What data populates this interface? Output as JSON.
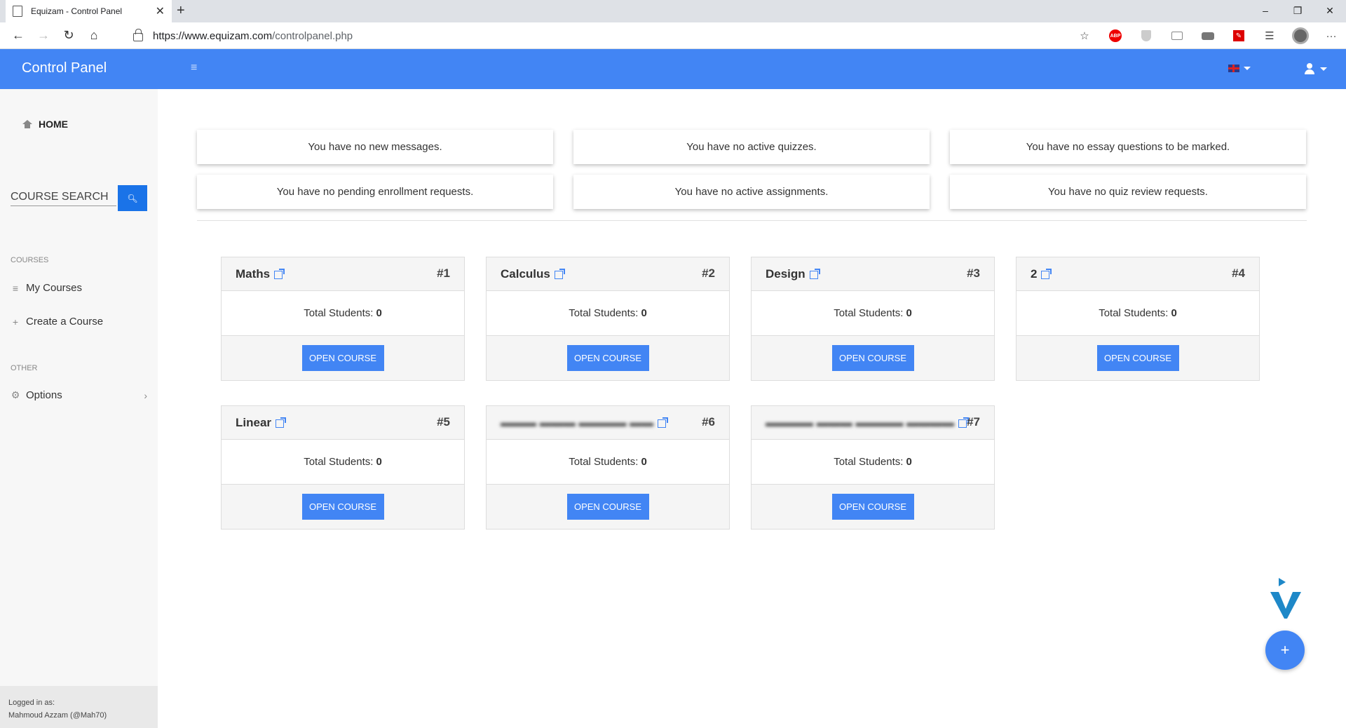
{
  "browser": {
    "tab_title": "Equizam - Control Panel",
    "url_host": "https://www.equizam.com",
    "url_path": "/controlpanel.php"
  },
  "appbar": {
    "brand": "Control Panel"
  },
  "sidebar": {
    "home": "HOME",
    "search_label": "COURSE SEARCH",
    "courses_heading": "COURSES",
    "my_courses": "My Courses",
    "create_course": "Create a Course",
    "other_heading": "OTHER",
    "options": "Options",
    "logged_in_label": "Logged in as:",
    "logged_in_user": "Mahmoud Azzam (@Mah70)"
  },
  "notices": [
    "You have no new messages.",
    "You have no active quizzes.",
    "You have no essay questions to be marked.",
    "You have no pending enrollment requests.",
    "You have no active assignments.",
    "You have no quiz review requests."
  ],
  "courses": [
    {
      "title": "Maths",
      "num": "#1",
      "students_label": "Total Students:",
      "students": "0",
      "button": "OPEN COURSE"
    },
    {
      "title": "Calculus",
      "num": "#2",
      "students_label": "Total Students:",
      "students": "0",
      "button": "OPEN COURSE"
    },
    {
      "title": "Design",
      "num": "#3",
      "students_label": "Total Students:",
      "students": "0",
      "button": "OPEN COURSE"
    },
    {
      "title": "2",
      "num": "#4",
      "students_label": "Total Students:",
      "students": "0",
      "button": "OPEN COURSE"
    },
    {
      "title": "Linear",
      "num": "#5",
      "students_label": "Total Students:",
      "students": "0",
      "button": "OPEN COURSE"
    },
    {
      "title": "",
      "num": "#6",
      "students_label": "Total Students:",
      "students": "0",
      "button": "OPEN COURSE"
    },
    {
      "title": "",
      "num": "#7",
      "students_label": "Total Students:",
      "students": "0",
      "button": "OPEN COURSE"
    }
  ],
  "icons": {
    "fab": "plus-icon"
  }
}
